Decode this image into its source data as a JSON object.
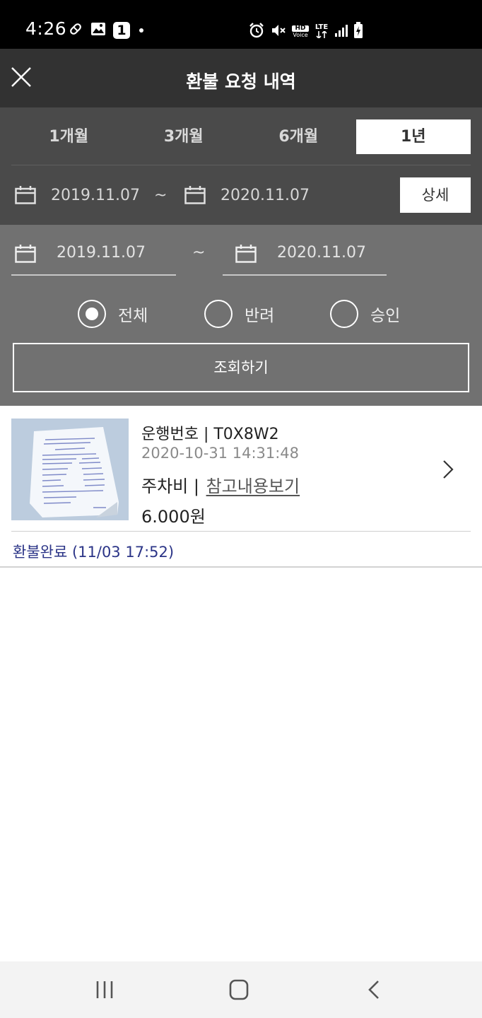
{
  "status_bar": {
    "time": "4:26",
    "notification_count": "1",
    "left_icons": [
      "pill-icon",
      "image-icon",
      "badge-1-icon",
      "dot-icon"
    ],
    "right_icons": [
      "alarm-icon",
      "mute-icon",
      "hd-voice-icon",
      "lte-icon",
      "signal-icon",
      "battery-icon"
    ],
    "hd_label": "HD",
    "voice_label": "Voice",
    "lte_label": "LTE"
  },
  "header": {
    "title": "환불 요청 내역",
    "close_icon": "close-icon"
  },
  "period_tabs": [
    {
      "label": "1개월",
      "active": false
    },
    {
      "label": "3개월",
      "active": false
    },
    {
      "label": "6개월",
      "active": false
    },
    {
      "label": "1년",
      "active": true
    }
  ],
  "range_summary": {
    "start": "2019.11.07",
    "separator": "~",
    "end": "2020.11.07",
    "detail_label": "상세"
  },
  "search": {
    "start_date": "2019.11.07",
    "separator": "~",
    "end_date": "2020.11.07",
    "radios": [
      {
        "label": "전체",
        "checked": true
      },
      {
        "label": "반려",
        "checked": false
      },
      {
        "label": "승인",
        "checked": false
      }
    ],
    "submit_label": "조회하기"
  },
  "results": [
    {
      "trip_label": "운행번호 | T0X8W2",
      "datetime": "2020-10-31 14:31:48",
      "fee_type": "주차비 | ",
      "ref_link": "참고내용보기",
      "amount": "6.000원",
      "status": "환불완료 (11/03 17:52)"
    }
  ],
  "colors": {
    "header_bg": "#323232",
    "filter_bg": "#4a4a4a",
    "search_bg": "#717171",
    "status_text": "#2b3487"
  },
  "nav_bar": {
    "icons": [
      "recent-apps-icon",
      "home-icon",
      "back-icon"
    ]
  }
}
